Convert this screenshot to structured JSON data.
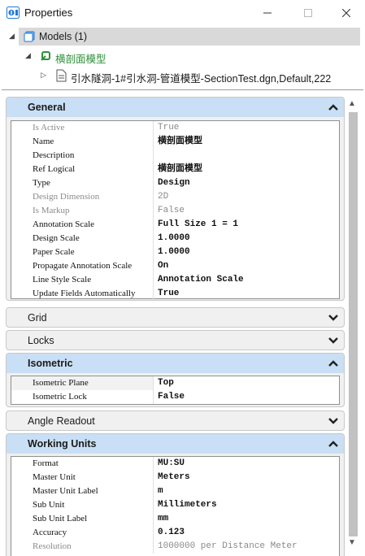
{
  "window": {
    "title": "Properties",
    "minimize_icon": "minimize-icon",
    "maximize_icon": "maximize-icon",
    "close_icon": "close-icon"
  },
  "tree": {
    "models_label": "Models (1)",
    "model_name": "横剖面模型",
    "file_label": "引水隧洞-1#引水洞-管道模型-SectionTest.dgn,Default,222",
    "model_color": "#2f8f3a"
  },
  "sections": {
    "general": {
      "title": "General",
      "rows": [
        {
          "name": "Is Active",
          "value": "True",
          "readonly": true
        },
        {
          "name": "Name",
          "value": "横剖面模型",
          "readonly": false
        },
        {
          "name": "Description",
          "value": "",
          "readonly": false
        },
        {
          "name": "Ref Logical",
          "value": "横剖面模型",
          "readonly": false
        },
        {
          "name": "Type",
          "value": "Design",
          "readonly": false
        },
        {
          "name": "Design Dimension",
          "value": "2D",
          "readonly": true
        },
        {
          "name": "Is Markup",
          "value": "False",
          "readonly": true
        },
        {
          "name": "Annotation Scale",
          "value": "Full Size 1 = 1",
          "readonly": false
        },
        {
          "name": "Design Scale",
          "value": "1.0000",
          "readonly": false
        },
        {
          "name": "Paper Scale",
          "value": "1.0000",
          "readonly": false
        },
        {
          "name": "Propagate Annotation Scale",
          "value": "On",
          "readonly": false
        },
        {
          "name": "Line Style Scale",
          "value": "Annotation Scale",
          "readonly": false
        },
        {
          "name": "Update Fields Automatically",
          "value": "True",
          "readonly": false
        }
      ]
    },
    "grid": {
      "title": "Grid"
    },
    "locks": {
      "title": "Locks"
    },
    "isometric": {
      "title": "Isometric",
      "rows": [
        {
          "name": "Isometric Plane",
          "value": "Top",
          "readonly": false
        },
        {
          "name": "Isometric Lock",
          "value": "False",
          "readonly": false
        }
      ]
    },
    "angle_readout": {
      "title": "Angle Readout"
    },
    "working_units": {
      "title": "Working Units",
      "rows": [
        {
          "name": "Format",
          "value": "MU:SU",
          "readonly": false
        },
        {
          "name": "Master Unit",
          "value": "Meters",
          "readonly": false
        },
        {
          "name": "Master Unit Label",
          "value": "m",
          "readonly": false
        },
        {
          "name": "Sub Unit",
          "value": "Millimeters",
          "readonly": false
        },
        {
          "name": "Sub Unit Label",
          "value": "mm",
          "readonly": false
        },
        {
          "name": "Accuracy",
          "value": "0.123",
          "readonly": false
        },
        {
          "name": "Resolution",
          "value": "1000000 per Distance Meter",
          "readonly": true
        }
      ]
    }
  },
  "colors": {
    "header_expanded": "#c9dff5",
    "section_bg": "#f0f0f0",
    "selection": "#d9d9d9",
    "accent_blue": "#1e78d7"
  }
}
